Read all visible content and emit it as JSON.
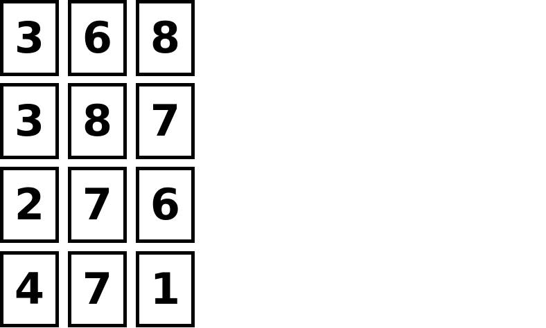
{
  "tiles": {
    "rows": [
      [
        "3",
        "6",
        "8"
      ],
      [
        "3",
        "8",
        "7"
      ],
      [
        "2",
        "7",
        "6"
      ],
      [
        "4",
        "7",
        "1"
      ]
    ]
  },
  "colors": {
    "border": "#000000",
    "text": "#000000",
    "background": "#ffffff"
  }
}
